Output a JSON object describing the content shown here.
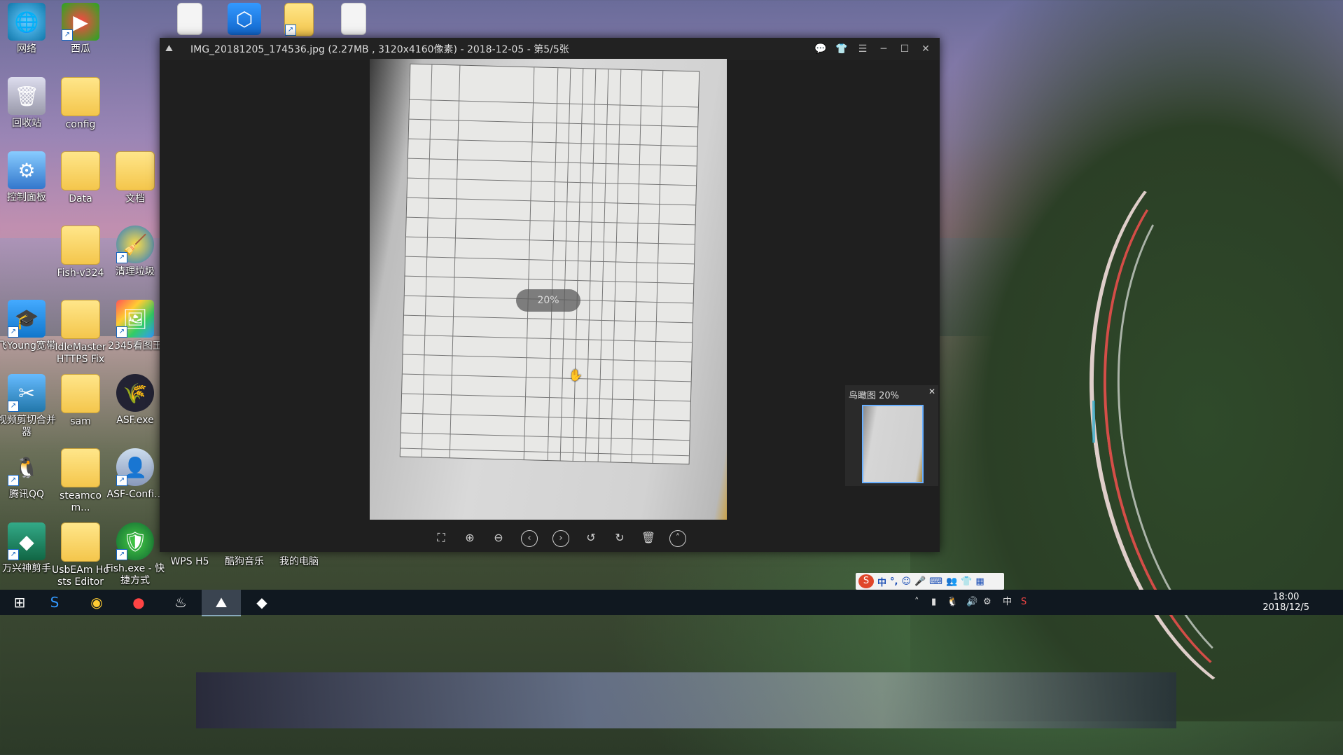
{
  "desktop": {
    "icons": [
      {
        "label": "网络"
      },
      {
        "label": "西瓜"
      },
      {
        "label": "回收站"
      },
      {
        "label": "config"
      },
      {
        "label": "控制面板"
      },
      {
        "label": "Data"
      },
      {
        "label": "文档"
      },
      {
        "label": "Fish-v324"
      },
      {
        "label": "清理垃圾"
      },
      {
        "label": "飞Young宽带"
      },
      {
        "label": "IdleMaster HTTPS Fix"
      },
      {
        "label": "2345看图王"
      },
      {
        "label": "视频剪切合并器"
      },
      {
        "label": "sam"
      },
      {
        "label": "ASF.exe"
      },
      {
        "label": "腾讯QQ"
      },
      {
        "label": "steamcom..."
      },
      {
        "label": "ASF-Confi..."
      },
      {
        "label": "万兴神剪手"
      },
      {
        "label": "UsbEAm Hosts Editor"
      },
      {
        "label": "Fish.exe - 快捷方式"
      },
      {
        "label": "WPS H5"
      },
      {
        "label": "酷狗音乐"
      },
      {
        "label": "我的电脑"
      }
    ]
  },
  "viewer": {
    "title": "IMG_20181205_174536.jpg (2.27MB , 3120x4160像素) - 2018-12-05 - 第5/5张",
    "zoom_badge": "20%",
    "navigator_label": "鸟瞰图 20%",
    "icons": {
      "app": "image-icon",
      "feedback": "chat-icon",
      "skin": "shirt-icon",
      "menu": "menu-icon",
      "minimize": "minimize-icon",
      "maximize": "maximize-icon",
      "close": "close-icon"
    },
    "toolbar": [
      "crop-icon",
      "zoom-in-icon",
      "zoom-out-icon",
      "previous-icon",
      "next-icon",
      "rotate-left-icon",
      "rotate-right-icon",
      "delete-icon",
      "more-icon"
    ]
  },
  "ime": {
    "lang": "中"
  },
  "taskbar": {
    "tray_lang": "中",
    "time": "18:00",
    "date": "2018/12/5"
  }
}
